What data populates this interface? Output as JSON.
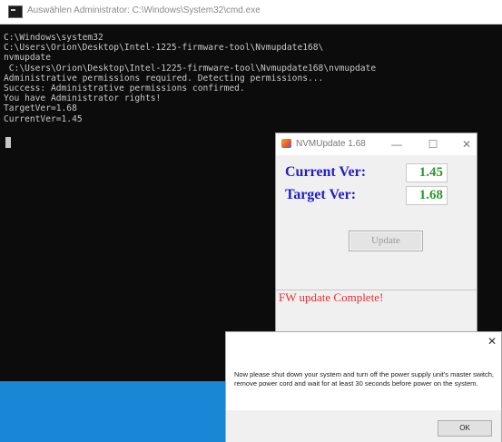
{
  "cmd": {
    "title": "Auswählen Administrator: C:\\Windows\\System32\\cmd.exe",
    "lines": [
      "C:\\Windows\\system32",
      "C:\\Users\\Orion\\Desktop\\Intel-1225-firmware-tool\\Nvmupdate168\\",
      "nvmupdate",
      " C:\\Users\\Orion\\Desktop\\Intel-1225-firmware-tool\\Nvmupdate168\\nvmupdate",
      "Administrative permissions required. Detecting permissions...",
      "Success: Administrative permissions confirmed.",
      "You have Administrator rights!",
      "TargetVer=1.68",
      "CurrentVer=1.45"
    ]
  },
  "nvm": {
    "title": "NVMUpdate 1.68",
    "min_glyph": "—",
    "max_glyph": "☐",
    "close_glyph": "✕",
    "current_label": "Current Ver:",
    "current_value": "1.45",
    "target_label": "Target Ver:",
    "target_value": "1.68",
    "update_label": "Update",
    "status": "FW update Complete!"
  },
  "message": {
    "close_glyph": "✕",
    "text": "Now please shut down your system and turn off the power supply unit's master switch, remove power cord and wait for at least 30 seconds before power on the system.",
    "ok_label": "OK"
  },
  "colors": {
    "console_bg": "#0c0c0c",
    "console_fg": "#c8c8c8",
    "version_label": "#1f1fc8",
    "version_value": "#2a9a2a",
    "status_red": "#e63030",
    "desktop_blue": "#1a86d6"
  }
}
